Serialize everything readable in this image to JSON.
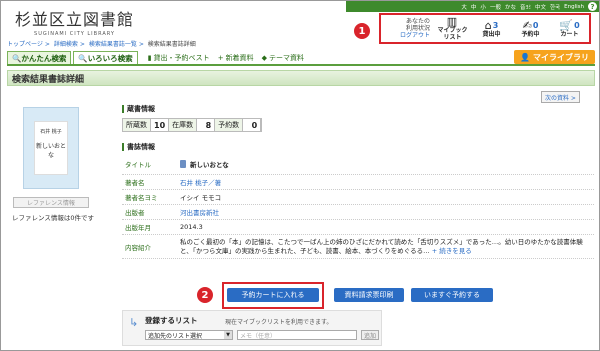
{
  "util_bar": {
    "items": [
      "大",
      "中",
      "小",
      "一般",
      "かな",
      "音ﾖﾐ",
      "中文",
      "한국",
      "English"
    ],
    "help_icon": "?"
  },
  "logo": {
    "jp": "杉並区立図書館",
    "en": "SUGINAMI CITY LIBRARY"
  },
  "user_panel": {
    "status_line1": "あなたの",
    "status_line2": "利用状況",
    "logout": "ログアウト",
    "items": [
      {
        "label": "マイブック\nリスト",
        "count": "",
        "icon": "books-icon"
      },
      {
        "label": "貸出中",
        "count": "3",
        "icon": "home-icon"
      },
      {
        "label": "予約中",
        "count": "0",
        "icon": "reserve-icon"
      },
      {
        "label": "カート",
        "count": "0",
        "icon": "cart-icon"
      }
    ]
  },
  "badges": {
    "one": "1",
    "two": "2"
  },
  "breadcrumb": {
    "items": [
      "トップページ",
      "詳細検索",
      "検索結果書誌一覧"
    ],
    "current": "検索結果書誌詳細"
  },
  "nav": {
    "tab_simple": "かんたん検索",
    "tab_various": "いろいろ検索",
    "link_best": "貸出・予約ベスト",
    "link_new": "新着資料",
    "link_theme": "テーマ資料",
    "mylibrary": "マイライブラリ"
  },
  "page_title": "検索結果書誌詳細",
  "next_button": "次の資料 >",
  "cover": {
    "small": "石井 桃子",
    "big": "新しいおとな"
  },
  "reference": {
    "button": "レファレンス情報",
    "text": "レファレンス情報は0件です"
  },
  "holdings": {
    "heading": "蔵書情報",
    "cells": [
      {
        "label": "所蔵数",
        "value": "10"
      },
      {
        "label": "在庫数",
        "value": "8"
      },
      {
        "label": "予約数",
        "value": "0"
      }
    ]
  },
  "bib": {
    "heading": "書誌情報",
    "rows": [
      {
        "key": "タイトル",
        "value": "新しいおとな"
      },
      {
        "key": "著者名",
        "value": "石井 桃子／著"
      },
      {
        "key": "著者名ヨミ",
        "value": "イシイ モモコ"
      },
      {
        "key": "出版者",
        "value": "河出書房新社"
      },
      {
        "key": "出版年月",
        "value": "2014.3"
      },
      {
        "key": "内容紹介",
        "value": "私のごく最初の「本」の記憶は、こたつで一ばん上の姉のひざにだかれて読めた「舌切りスズメ」であった…。幼い日のゆたかな読書体験と、「かつら文庫」の実践から生まれた、子ども、読書、絵本、本づくりをめぐるる…",
        "more": "+ 続きを見る"
      }
    ]
  },
  "buttons": {
    "cart": "予約カートに入れる",
    "print": "資料請求票印刷",
    "reserve": "いますぐ予約する"
  },
  "register": {
    "title": "登録するリスト",
    "note": "現在マイブックリストを利用できます。",
    "select_value": "追加先のリスト選択",
    "memo_placeholder": "メモ（任意）",
    "add": "追加"
  }
}
